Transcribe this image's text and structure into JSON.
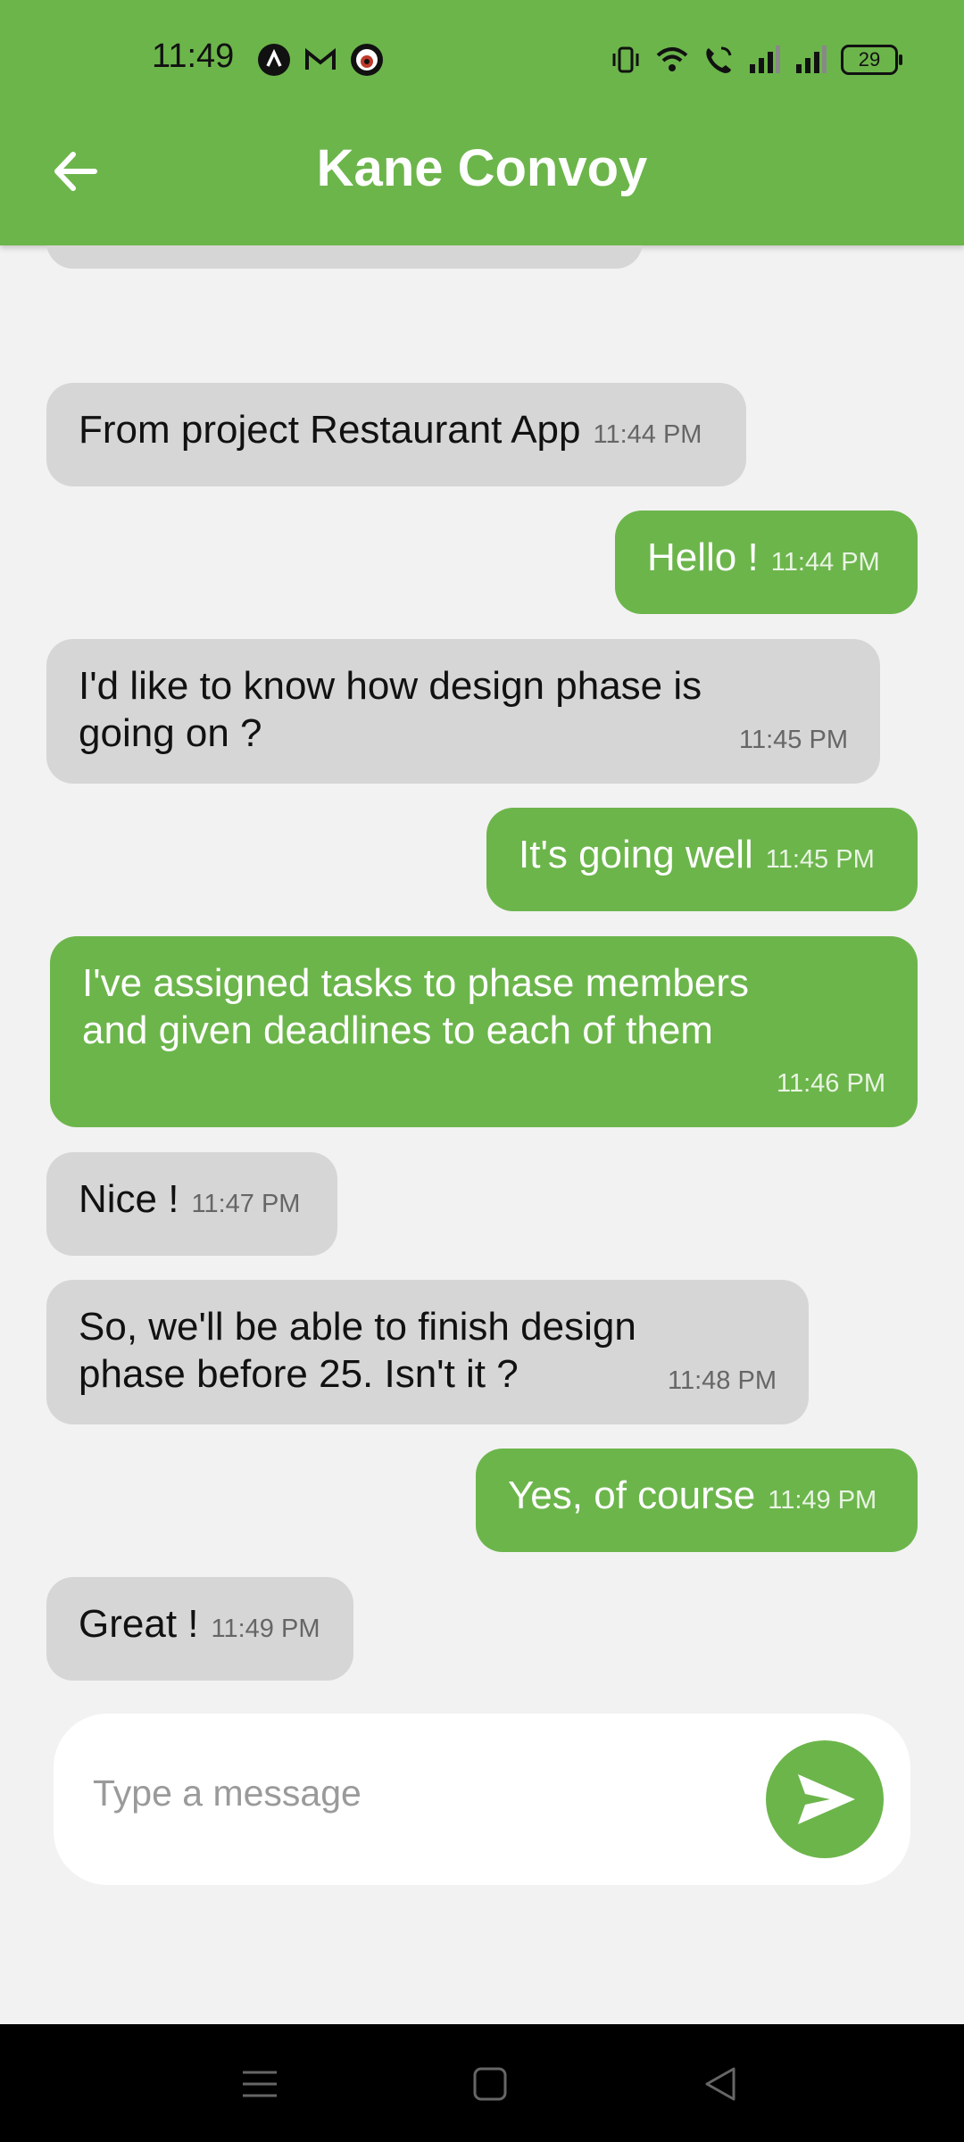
{
  "status_bar": {
    "time": "11:49",
    "battery": "29",
    "icons_left": [
      "launcher-icon",
      "gmail-icon",
      "eye-app-icon"
    ],
    "icons_right": [
      "vibrate-icon",
      "wifi-icon",
      "wifi-call-icon",
      "signal-icon",
      "signal-icon"
    ]
  },
  "header": {
    "title": "Kane Convoy",
    "back_icon": "back-arrow-icon",
    "color": "#6cb54b"
  },
  "messages": [
    {
      "direction": "in",
      "text": "From project Restaurant App",
      "time": "11:44 PM"
    },
    {
      "direction": "out",
      "text": "Hello !",
      "time": "11:44 PM"
    },
    {
      "direction": "in",
      "text": "I'd like to know how design phase is going on ?",
      "time": "11:45 PM"
    },
    {
      "direction": "out",
      "text": "It's going well",
      "time": "11:45 PM"
    },
    {
      "direction": "out",
      "text": "I've assigned tasks to phase members and given deadlines to each of them",
      "time": "11:46 PM"
    },
    {
      "direction": "in",
      "text": "Nice !",
      "time": "11:47 PM"
    },
    {
      "direction": "in",
      "text": "So, we'll be able to finish design phase before 25. Isn't it ?",
      "time": "11:48 PM"
    },
    {
      "direction": "out",
      "text": "Yes, of course",
      "time": "11:49 PM"
    },
    {
      "direction": "in",
      "text": "Great !",
      "time": "11:49 PM"
    }
  ],
  "composer": {
    "placeholder": "Type a message",
    "send_icon": "send-icon"
  },
  "nav_bar": {
    "icons": [
      "recents-icon",
      "home-icon",
      "back-icon"
    ]
  }
}
